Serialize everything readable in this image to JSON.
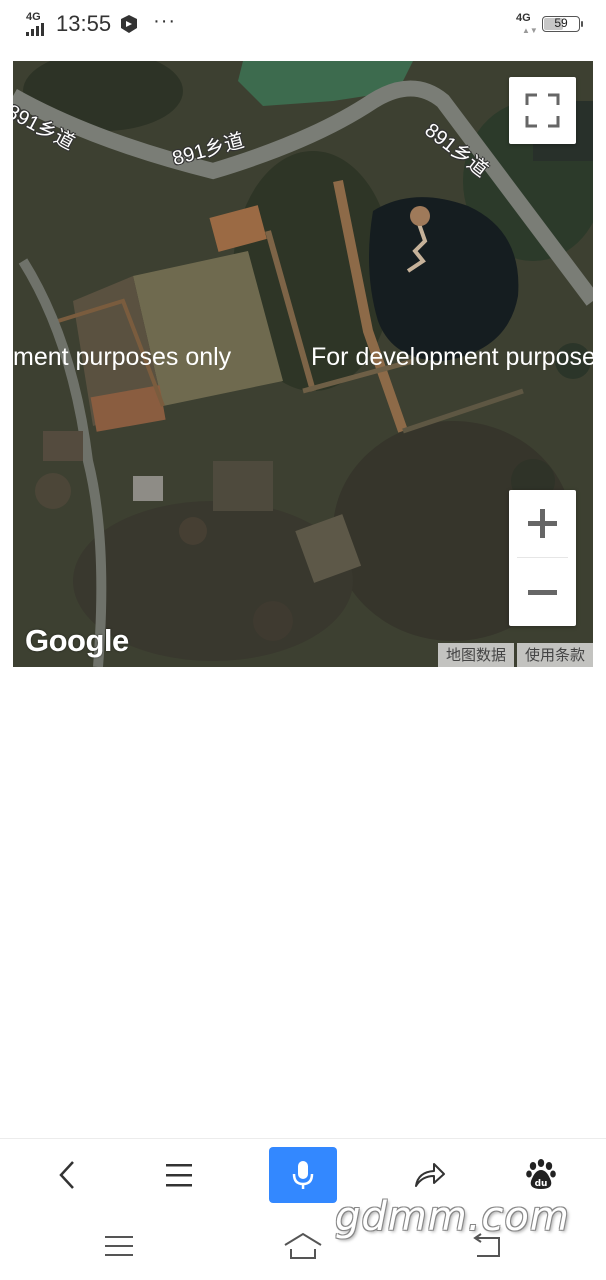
{
  "status_bar": {
    "network": "4G",
    "time": "13:55",
    "more": "···",
    "network_right": "4G",
    "battery_level": "59",
    "battery_fraction": 0.59
  },
  "map": {
    "road_label": "891乡道",
    "watermark_left": "ment purposes only",
    "watermark_right": "For development purpose",
    "logo": "Google",
    "attribution_data": "地图数据",
    "attribution_terms": "使用条款"
  },
  "toolbar": {
    "accent_color": "#3388ff",
    "icons": [
      "back-icon",
      "menu-icon",
      "microphone-icon",
      "share-icon",
      "baidu-paw-icon"
    ]
  },
  "system_nav": {
    "icons": [
      "menu-icon",
      "home-icon",
      "return-icon"
    ]
  },
  "watermark": {
    "site": "gdmm.com"
  }
}
